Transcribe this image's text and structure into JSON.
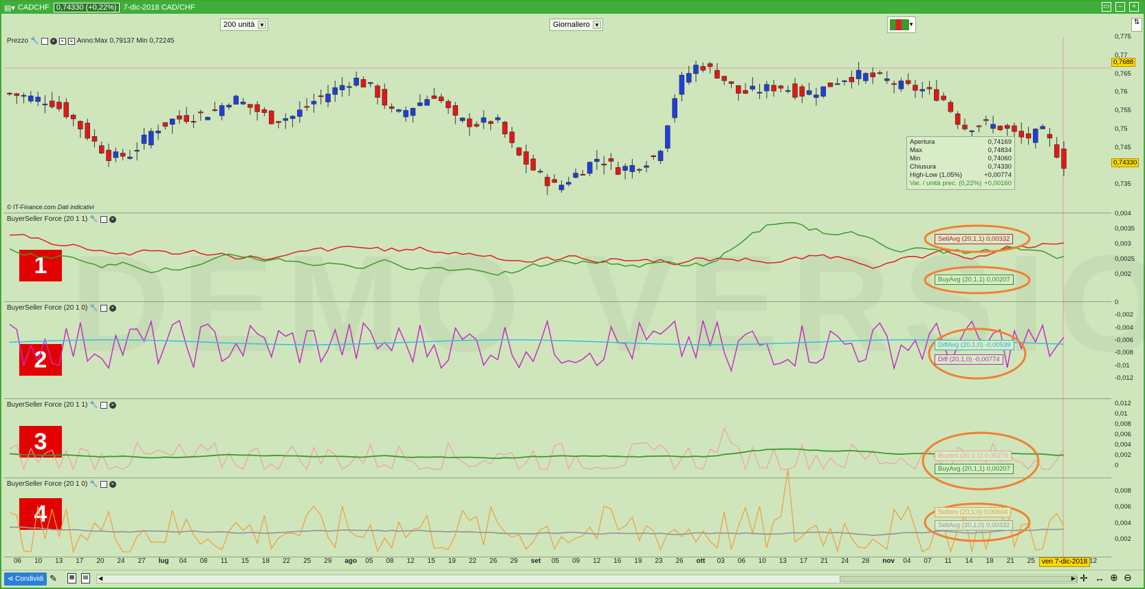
{
  "titlebar": {
    "ticker": "CADCHF",
    "price": "0,74330 (+0,22%)",
    "date_pair": "7-dic-2018 CAD/CHF"
  },
  "toolbar": {
    "units_select": "200 unità",
    "period_select": "Giornaliero"
  },
  "panels": {
    "price": {
      "label": "Prezzo",
      "range_text": "Anno:Max 0,79137 Min 0,72245",
      "copyright": "© IT-Finance.com",
      "disclaimer": "Dati indicativi",
      "y_ticks": [
        "0,775",
        "0,77",
        "0,765",
        "0,76",
        "0,755",
        "0,75",
        "0,745",
        "0,74",
        "0,735"
      ],
      "current_tag": "0,74330",
      "cursor_tag": "0,7688"
    },
    "p1": {
      "label": "BuyerSeller Force (20 1 1)",
      "badge": "1",
      "y_ticks": [
        "0,004",
        "0,0035",
        "0,003",
        "0,0025",
        "0,002"
      ],
      "legend_sell": "SellAvg (20,1,1)   0,00332",
      "legend_buy": "BuyAvg (20,1,1)   0,00207"
    },
    "p2": {
      "label": "BuyerSeller Force (20 1 0)",
      "badge": "2",
      "y_ticks": [
        "0",
        "-0,002",
        "-0,004",
        "-0,006",
        "-0,008",
        "-0,01",
        "-0,012"
      ],
      "legend_diffavg": "DiffAvg (20,1,0)   -0,00539",
      "legend_diff": "Diff (20,1,0)        -0,00774"
    },
    "p3": {
      "label": "BuyerSeller Force (20 1 1)",
      "badge": "3",
      "y_ticks": [
        "0,012",
        "0,01",
        "0,008",
        "0,006",
        "0,004",
        "0,002",
        "0"
      ],
      "legend_buyers": "Buyers (20,1,1)   0,00270",
      "legend_buyavg": "BuyAvg (20,1,1)   0,00207"
    },
    "p4": {
      "label": "BuyerSeller Force (20 1 0)",
      "badge": "4",
      "y_ticks": [
        "0,008",
        "0,006",
        "0,004",
        "0,002"
      ],
      "legend_sellers": "Sellers (20,1,0)   0,00504",
      "legend_sellavg": "SellAvg (20,1,0)   0,00332"
    }
  },
  "info_box": {
    "rows": [
      {
        "k": "Apertura",
        "v": "0,74169"
      },
      {
        "k": "Max",
        "v": "0,74834"
      },
      {
        "k": "Min",
        "v": "0,74060"
      },
      {
        "k": "Chiusura",
        "v": "0,74330"
      },
      {
        "k": "High-Low (1,05%)",
        "v": "+0,00774"
      },
      {
        "k": "Var. / unità prec. (0,22%)",
        "v": "+0,00160"
      }
    ]
  },
  "watermark": "DEMO VERSION",
  "xaxis": {
    "labels": [
      "06",
      "10",
      "13",
      "17",
      "20",
      "24",
      "27",
      "lug",
      "04",
      "08",
      "11",
      "15",
      "18",
      "22",
      "25",
      "29",
      "ago",
      "05",
      "08",
      "12",
      "15",
      "19",
      "22",
      "26",
      "29",
      "set",
      "05",
      "09",
      "12",
      "16",
      "19",
      "23",
      "26",
      "ott",
      "03",
      "06",
      "10",
      "13",
      "17",
      "21",
      "24",
      "28",
      "nov",
      "04",
      "07",
      "11",
      "14",
      "18",
      "21",
      "25",
      "28",
      "dic",
      "12"
    ],
    "current": "ven 7-dic-2018"
  },
  "statusbar": {
    "share_label": "Condividi"
  },
  "colors": {
    "bull": "#1f3fd6",
    "bear": "#e01818",
    "sell": "#e02020",
    "buy": "#3a9a2a",
    "diff": "#c030c0",
    "diffavg": "#30c0e0",
    "buyers": "#f0a0a0",
    "sellers": "#f0a040",
    "sellavg": "#999999",
    "highlight": "#f08030"
  },
  "chart_data": {
    "type": "line",
    "title": "CADCHF",
    "ohlc_sample": {
      "x": [
        "06",
        "10",
        "13",
        "17",
        "20",
        "24",
        "27",
        "lug",
        "04",
        "08",
        "11",
        "15",
        "18",
        "22",
        "25",
        "29",
        "ago",
        "05",
        "08",
        "12",
        "15",
        "19",
        "22",
        "26",
        "29",
        "set",
        "05",
        "09",
        "12",
        "16",
        "19",
        "23",
        "26",
        "ott",
        "03",
        "06",
        "10",
        "13",
        "17",
        "21",
        "24",
        "28",
        "nov",
        "04",
        "07",
        "11",
        "14",
        "18",
        "21",
        "25",
        "28",
        "dic",
        "07"
      ],
      "close": [
        0.762,
        0.761,
        0.76,
        0.756,
        0.75,
        0.745,
        0.746,
        0.752,
        0.755,
        0.756,
        0.757,
        0.761,
        0.758,
        0.755,
        0.756,
        0.76,
        0.763,
        0.766,
        0.763,
        0.756,
        0.759,
        0.762,
        0.755,
        0.754,
        0.755,
        0.746,
        0.741,
        0.737,
        0.741,
        0.745,
        0.742,
        0.743,
        0.746,
        0.765,
        0.77,
        0.767,
        0.762,
        0.763,
        0.764,
        0.762,
        0.763,
        0.766,
        0.767,
        0.766,
        0.764,
        0.763,
        0.761,
        0.753,
        0.754,
        0.753,
        0.75,
        0.752,
        0.7433
      ]
    },
    "ylim": [
      0.731,
      0.777
    ]
  }
}
